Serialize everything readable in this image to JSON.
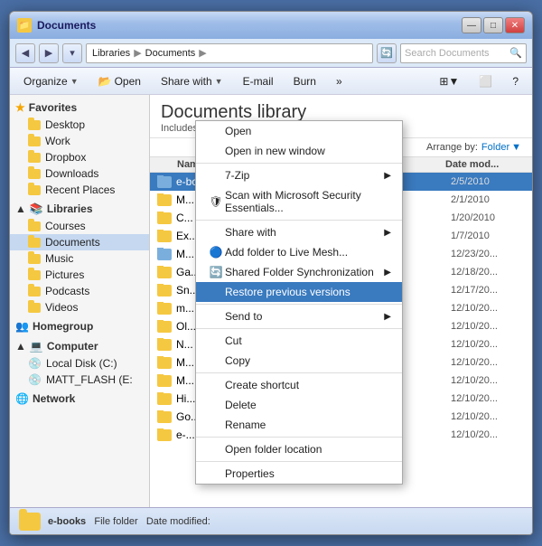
{
  "window": {
    "title": "Documents",
    "title_icon": "📁"
  },
  "titlebar_buttons": {
    "minimize": "—",
    "maximize": "□",
    "close": "✕"
  },
  "address_bar": {
    "back": "◀",
    "forward": "▶",
    "recent": "▾",
    "path": "Libraries ▶ Documents ▶",
    "refresh": "🔄",
    "search_placeholder": "Search Documents",
    "search_icon": "🔍"
  },
  "toolbar": {
    "organize": "Organize",
    "open": "Open",
    "share_with": "Share with",
    "email": "E-mail",
    "burn": "Burn",
    "more": "»",
    "view_icon": "⊞",
    "details": "▼",
    "preview": "⬜",
    "help": "?"
  },
  "sidebar": {
    "favorites_header": "Favorites",
    "favorites_items": [
      {
        "label": "Desktop",
        "icon": "folder"
      },
      {
        "label": "Work",
        "icon": "folder"
      },
      {
        "label": "Dropbox",
        "icon": "folder"
      },
      {
        "label": "Downloads",
        "icon": "folder"
      },
      {
        "label": "Recent Places",
        "icon": "folder"
      }
    ],
    "libraries_header": "Libraries",
    "libraries_items": [
      {
        "label": "Courses",
        "icon": "folder"
      },
      {
        "label": "Documents",
        "icon": "folder",
        "selected": true
      },
      {
        "label": "Music",
        "icon": "folder"
      },
      {
        "label": "Pictures",
        "icon": "folder"
      },
      {
        "label": "Podcasts",
        "icon": "folder"
      },
      {
        "label": "Videos",
        "icon": "folder"
      }
    ],
    "homegroup": "Homegroup",
    "computer_header": "Computer",
    "computer_items": [
      {
        "label": "Local Disk (C:)",
        "icon": "drive"
      },
      {
        "label": "MATT_FLASH (E:",
        "icon": "drive"
      }
    ],
    "network": "Network"
  },
  "main": {
    "library_title": "Documents library",
    "library_subtitle": "Includes: 2 locations",
    "arrange_label": "Arrange by:",
    "arrange_value": "Folder",
    "col_name": "Name",
    "col_date": "Date mod...",
    "files": [
      {
        "name": "e-books",
        "date": "2/5/2010",
        "highlighted": true
      },
      {
        "name": "M...",
        "date": "2/1/2010"
      },
      {
        "name": "C...",
        "date": "1/20/2010"
      },
      {
        "name": "Ex...",
        "date": "1/7/2010"
      },
      {
        "name": "M...",
        "date": "12/23/20..."
      },
      {
        "name": "Ga...",
        "date": "12/18/20..."
      },
      {
        "name": "Sn...",
        "date": "12/17/20..."
      },
      {
        "name": "m...",
        "date": "12/10/20..."
      },
      {
        "name": "Ol...",
        "date": "12/10/20..."
      },
      {
        "name": "N...",
        "date": "12/10/20..."
      },
      {
        "name": "M...",
        "date": "12/10/20..."
      },
      {
        "name": "M...",
        "date": "12/10/20..."
      },
      {
        "name": "Hi...",
        "date": "12/10/20..."
      },
      {
        "name": "Go...",
        "date": "12/10/20..."
      },
      {
        "name": "e-...",
        "date": "12/10/20..."
      }
    ]
  },
  "context_menu": {
    "items": [
      {
        "label": "Open",
        "type": "item",
        "has_arrow": false,
        "icon": ""
      },
      {
        "label": "Open in new window",
        "type": "item",
        "has_arrow": false,
        "icon": ""
      },
      {
        "label": "7-Zip",
        "type": "item",
        "has_arrow": true,
        "icon": ""
      },
      {
        "label": "Scan with Microsoft Security Essentials...",
        "type": "item",
        "has_arrow": false,
        "icon": "🛡"
      },
      {
        "label": "Share with",
        "type": "item",
        "has_arrow": true,
        "icon": ""
      },
      {
        "label": "Add folder to Live Mesh...",
        "type": "item",
        "has_arrow": false,
        "icon": "🔵"
      },
      {
        "label": "Shared Folder Synchronization",
        "type": "item",
        "has_arrow": true,
        "icon": "🔄"
      },
      {
        "label": "Restore previous versions",
        "type": "item-hovered",
        "has_arrow": false,
        "icon": ""
      },
      {
        "label": "Send to",
        "type": "item",
        "has_arrow": true,
        "icon": ""
      },
      {
        "label": "Cut",
        "type": "item",
        "has_arrow": false,
        "icon": ""
      },
      {
        "label": "Copy",
        "type": "item",
        "has_arrow": false,
        "icon": ""
      },
      {
        "label": "Create shortcut",
        "type": "item",
        "has_arrow": false,
        "icon": ""
      },
      {
        "label": "Delete",
        "type": "item",
        "has_arrow": false,
        "icon": ""
      },
      {
        "label": "Rename",
        "type": "item",
        "has_arrow": false,
        "icon": ""
      },
      {
        "label": "Open folder location",
        "type": "item",
        "has_arrow": false,
        "icon": ""
      },
      {
        "label": "Properties",
        "type": "item",
        "has_arrow": false,
        "icon": ""
      }
    ]
  },
  "status_bar": {
    "name": "e-books",
    "type": "File folder",
    "date_modified_label": "Date modified:"
  }
}
